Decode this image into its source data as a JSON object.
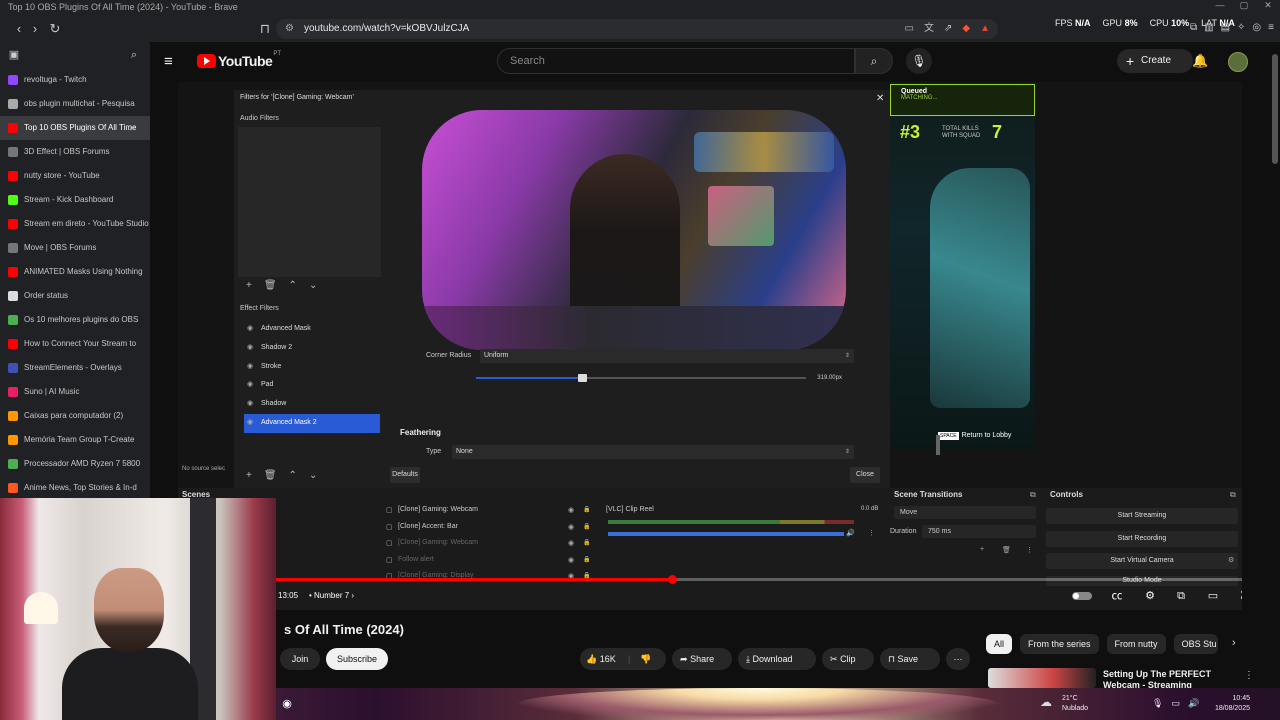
{
  "browser": {
    "window_title": "Top 10 OBS Plugins Of All Time (2024) - YouTube - Brave",
    "url": "youtube.com/watch?v=kOBVJulzCJA",
    "hud": {
      "fps_label": "FPS",
      "fps_value": "N/A",
      "gpu_label": "GPU",
      "gpu_value": "8%",
      "cpu_label": "CPU",
      "cpu_value": "10%",
      "lat_label": "LAT",
      "lat_value": "N/A"
    }
  },
  "sidebar": {
    "tabs": [
      {
        "label": "revoltuga - Twitch",
        "color": "#9147ff"
      },
      {
        "label": "obs plugin multichat - Pesquisa",
        "color": "#aaaaaa"
      },
      {
        "label": "Top 10 OBS Plugins Of All Time",
        "color": "#ff0000",
        "active": true
      },
      {
        "label": "3D Effect | OBS Forums",
        "color": "#777777"
      },
      {
        "label": "nutty store - YouTube",
        "color": "#ff0000"
      },
      {
        "label": "Stream - Kick Dashboard",
        "color": "#53fc18"
      },
      {
        "label": "Stream em direto - YouTube Studio",
        "color": "#ff0000"
      },
      {
        "label": "Move | OBS Forums",
        "color": "#777777"
      },
      {
        "label": "ANIMATED Masks Using Nothing",
        "color": "#ff0000"
      },
      {
        "label": "Order status",
        "color": "#dddddd"
      },
      {
        "label": "Os 10 melhores plugins do OBS",
        "color": "#4caf50"
      },
      {
        "label": "How to Connect Your Stream to",
        "color": "#ff0000"
      },
      {
        "label": "StreamElements - Overlays",
        "color": "#3f51b5"
      },
      {
        "label": "Suno | AI Music",
        "color": "#e91e63"
      },
      {
        "label": "Caixas para computador (2)",
        "color": "#ff9800"
      },
      {
        "label": "Memória Team Group T-Create",
        "color": "#ff9800"
      },
      {
        "label": "Processador AMD Ryzen 7 5800",
        "color": "#4caf50"
      },
      {
        "label": "Anime News, Top Stories & In-d",
        "color": "#ff5722"
      }
    ]
  },
  "youtube": {
    "logo_text": "YouTube",
    "logo_country": "PT",
    "search_placeholder": "Search",
    "create_label": "Create"
  },
  "obs_filters": {
    "title": "Filters for '[Clone] Gaming: Webcam'",
    "audio_filters_label": "Audio Filters",
    "effect_filters_label": "Effect Filters",
    "effects": [
      {
        "label": "Advanced Mask",
        "selected": false
      },
      {
        "label": "Shadow 2",
        "selected": false
      },
      {
        "label": "Stroke",
        "selected": false
      },
      {
        "label": "Pad",
        "selected": false
      },
      {
        "label": "Shadow",
        "selected": false
      },
      {
        "label": "Advanced Mask 2",
        "selected": true
      }
    ],
    "corner_radius_label": "Corner Radius",
    "corner_radius_mode": "Uniform",
    "corner_radius_value": "319.00px",
    "corner_radius_fraction": 0.32,
    "feathering_label": "Feathering",
    "type_label": "Type",
    "type_value": "None",
    "defaults_label": "Defaults",
    "close_label": "Close",
    "no_source_label": "No source selec"
  },
  "game": {
    "queued_label": "Queued",
    "queued_sub": "MATCHING...",
    "rank": "#3",
    "kills_label": "TOTAL KILLS WITH SQUAD",
    "kills_value": "7",
    "lobby_key": "SPACE",
    "lobby_label": "Return to Lobby"
  },
  "obs_docks": {
    "scenes_label": "Scenes",
    "sources": [
      {
        "label": "[Clone] Gaming: Webcam",
        "dim": false
      },
      {
        "label": "[Clone] Accent: Bar",
        "dim": false
      },
      {
        "label": "[Clone] Gaming: Webcam",
        "dim": true
      },
      {
        "label": "Follow alert",
        "dim": true
      },
      {
        "label": "[Clone] Gaming: Display",
        "dim": true
      }
    ],
    "mixer_source": "[VLC] Clip Reel",
    "mixer_db": "0.0 dB",
    "scene_transitions_label": "Scene Transitions",
    "transition_value": "Move",
    "duration_label": "Duration",
    "duration_value": "750 ms",
    "controls_label": "Controls",
    "controls": [
      "Start Streaming",
      "Start Recording",
      "Start Virtual Camera",
      "Studio Mode"
    ]
  },
  "player": {
    "time": "13:05",
    "chapter": "Number 7",
    "progress_fraction": 0.41
  },
  "video": {
    "title_visible": "s Of All Time (2024)",
    "join_label": "Join",
    "subscribe_label": "Subscribe",
    "likes": "16K",
    "share_label": "Share",
    "download_label": "Download",
    "clip_label": "Clip",
    "save_label": "Save"
  },
  "chips": [
    "All",
    "From the series",
    "From nutty",
    "OBS Stu"
  ],
  "related": {
    "title": "Setting Up The PERFECT Webcam - Streaming"
  },
  "taskbar": {
    "temperature": "21°C",
    "weather": "Nublado",
    "time": "10:45",
    "date": "18/08/2025"
  }
}
